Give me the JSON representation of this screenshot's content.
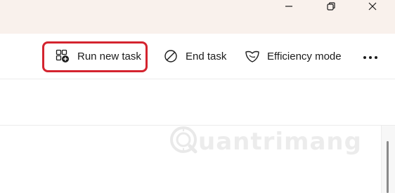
{
  "window": {
    "controls": {
      "minimize_icon": "minimize-icon",
      "maximize_icon": "restore-icon",
      "close_icon": "close-icon"
    }
  },
  "toolbar": {
    "run_new_task": {
      "label": "Run new task",
      "icon": "run-task-icon"
    },
    "end_task": {
      "label": "End task",
      "icon": "end-task-icon"
    },
    "efficiency_mode": {
      "label": "Efficiency mode",
      "icon": "leaf-heart-icon"
    },
    "more": {
      "icon": "more-options-icon"
    }
  },
  "highlight": {
    "color": "#d4242f",
    "target": "Run new task"
  },
  "watermark": {
    "text": "uantrimang"
  },
  "colors": {
    "titlebar_bg": "#f9f1ec",
    "highlight": "#d4242f"
  }
}
